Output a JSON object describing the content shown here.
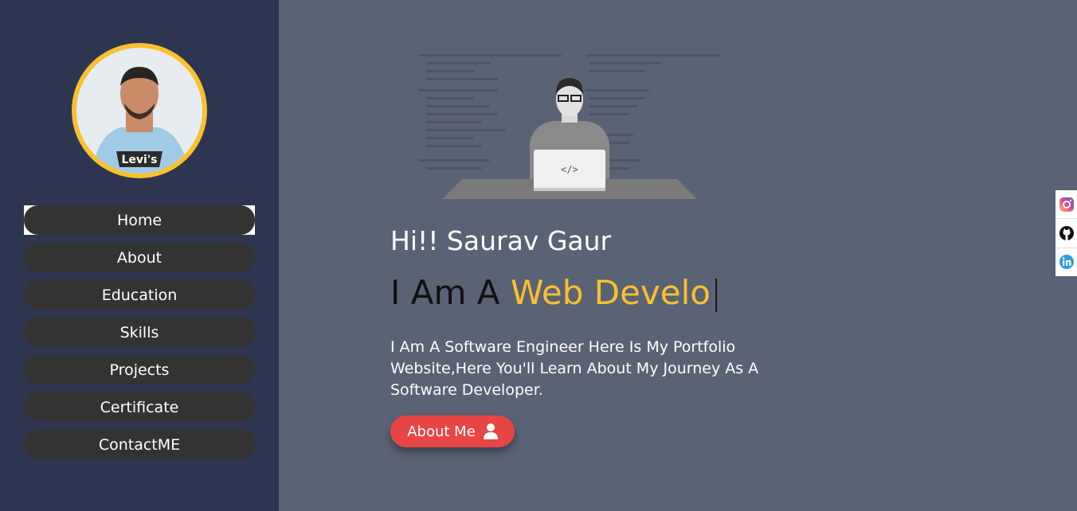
{
  "nav": {
    "items": [
      {
        "label": "Home"
      },
      {
        "label": "About"
      },
      {
        "label": "Education"
      },
      {
        "label": "Skills"
      },
      {
        "label": "Projects"
      },
      {
        "label": "Certificate"
      },
      {
        "label": "ContactME"
      }
    ]
  },
  "avatar": {
    "shirt_text": "Levi's"
  },
  "hero": {
    "greeting": "Hi!! Saurav Gaur",
    "role_prefix": "I Am A ",
    "role_highlight": "Web Develo",
    "role_caret": "|",
    "description": "I Am A Software Engineer Here Is My Portfolio Website,Here You'll Learn About My Journey As A Software Developer.",
    "button_label": "About Me"
  },
  "colors": {
    "sidebar": "#2d3550",
    "main": "#5a6275",
    "accent": "#fbc02d",
    "button": "#e84545"
  },
  "icons": [
    "user-icon",
    "instagram-icon",
    "github-icon",
    "linkedin-icon"
  ]
}
